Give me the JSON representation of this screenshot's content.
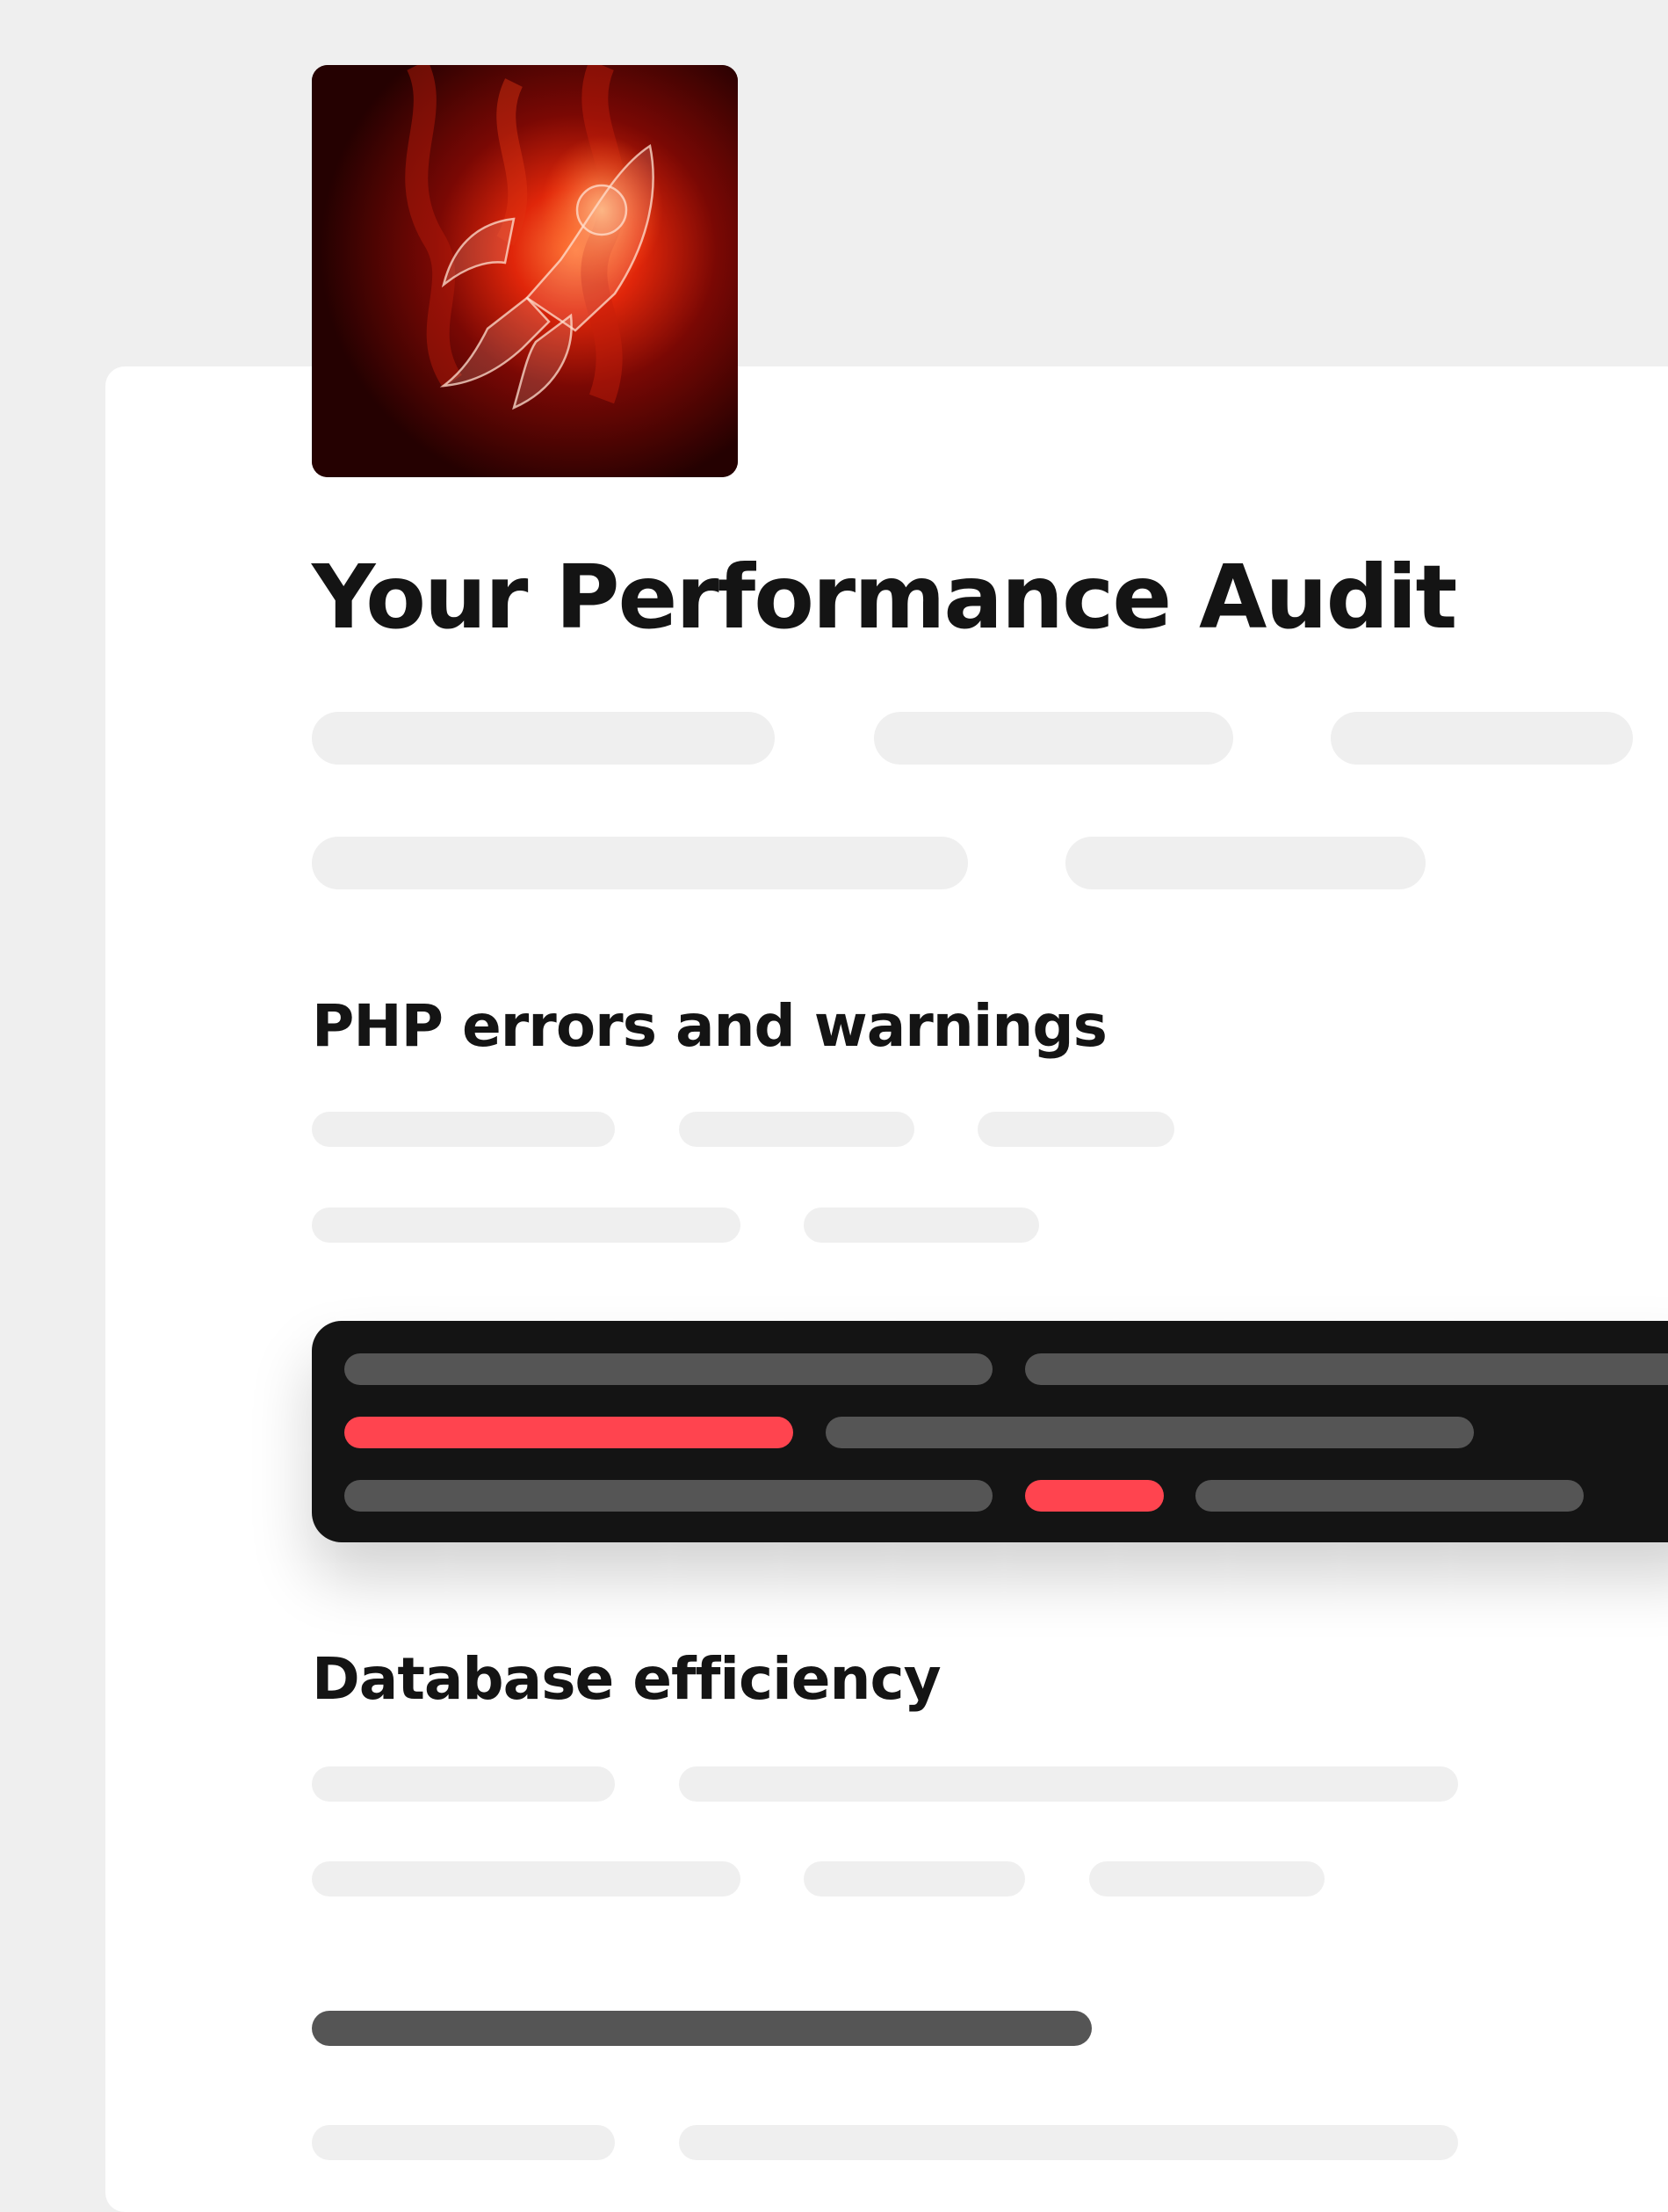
{
  "header": {
    "logo_icon": "rocket-icon"
  },
  "report": {
    "title": "Your Performance Audit"
  },
  "sections": [
    {
      "title": "PHP errors and warnings"
    },
    {
      "title": "Database efficiency"
    }
  ],
  "console": {
    "error_indicator_color": "#ff444f",
    "text_placeholder_color": "#555555",
    "background_color": "#141414"
  },
  "colors": {
    "page_background": "#efefef",
    "card_background": "#ffffff",
    "placeholder": "#efefef",
    "heading_text": "#141414"
  }
}
